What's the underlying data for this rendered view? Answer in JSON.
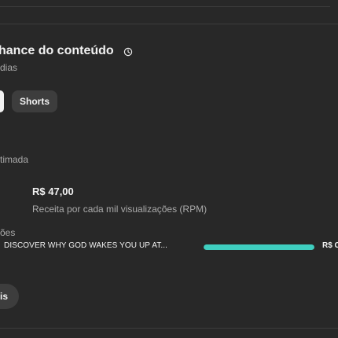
{
  "card": {
    "title": "hance do conteúdo",
    "subtitle": "dias",
    "chips": {
      "shorts_label": "Shorts"
    },
    "metric_label": "timada",
    "left_stat_caption": "ões",
    "stat": {
      "value": "R$ 47,00",
      "caption": "Receita por cada mil visualizações (RPM)"
    },
    "video": {
      "title": "DISCOVER WHY GOD WAKES YOU UP AT...",
      "value": "R$ C",
      "bar_fraction": 1.0
    },
    "more_button_label": "is"
  },
  "icons": {
    "clock": "clock-icon"
  },
  "colors": {
    "background": "#282828",
    "chip": "#3d3d3d",
    "bar": "#3fcfc0",
    "muted_text": "#aaaaaa"
  }
}
